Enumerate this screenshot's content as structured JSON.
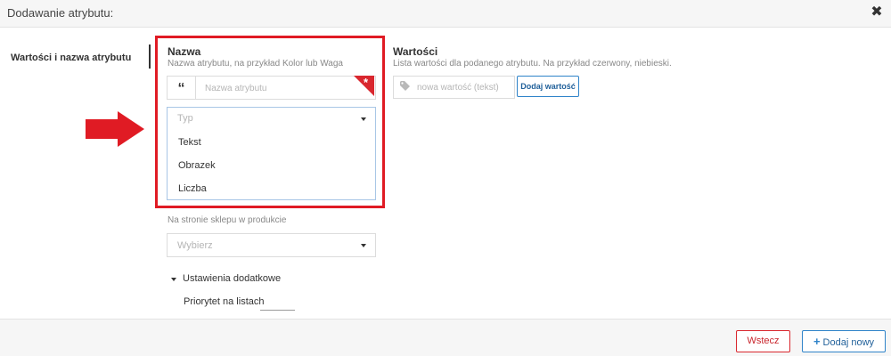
{
  "window": {
    "title": "Dodawanie atrybutu:",
    "close_icon": "close-icon"
  },
  "sidebar": {
    "active_tab": "Wartości i nazwa atrybutu"
  },
  "name_section": {
    "label": "Nazwa",
    "help": "Nazwa atrybutu, na przykład Kolor lub Waga",
    "input_placeholder": "Nazwa atrybutu",
    "input_icon": "quote-icon",
    "required_marker": "*"
  },
  "type_select": {
    "placeholder": "Typ",
    "options": [
      "Tekst",
      "Obrazek",
      "Liczba"
    ],
    "is_open": true
  },
  "values_section": {
    "label": "Wartości",
    "help": "Lista wartości dla podanego atrybutu. Na przykład czerwony, niebieski.",
    "input_placeholder": "nowa wartość (tekst)",
    "input_icon": "tag-icon",
    "add_button": "Dodaj wartość"
  },
  "product_page": {
    "help": "Na stronie sklepu w produkcie",
    "select_placeholder": "Wybierz"
  },
  "extra_settings": {
    "toggle_label": "Ustawienia dodatkowe",
    "priority_label": "Priorytet na listach",
    "priority_value": ""
  },
  "footer": {
    "back_button": "Wstecz",
    "add_new_button": "Dodaj nowy"
  },
  "colors": {
    "highlight": "#e01b24",
    "primary": "#2f83c9",
    "danger": "#d9272e",
    "required": "#d9272e"
  }
}
